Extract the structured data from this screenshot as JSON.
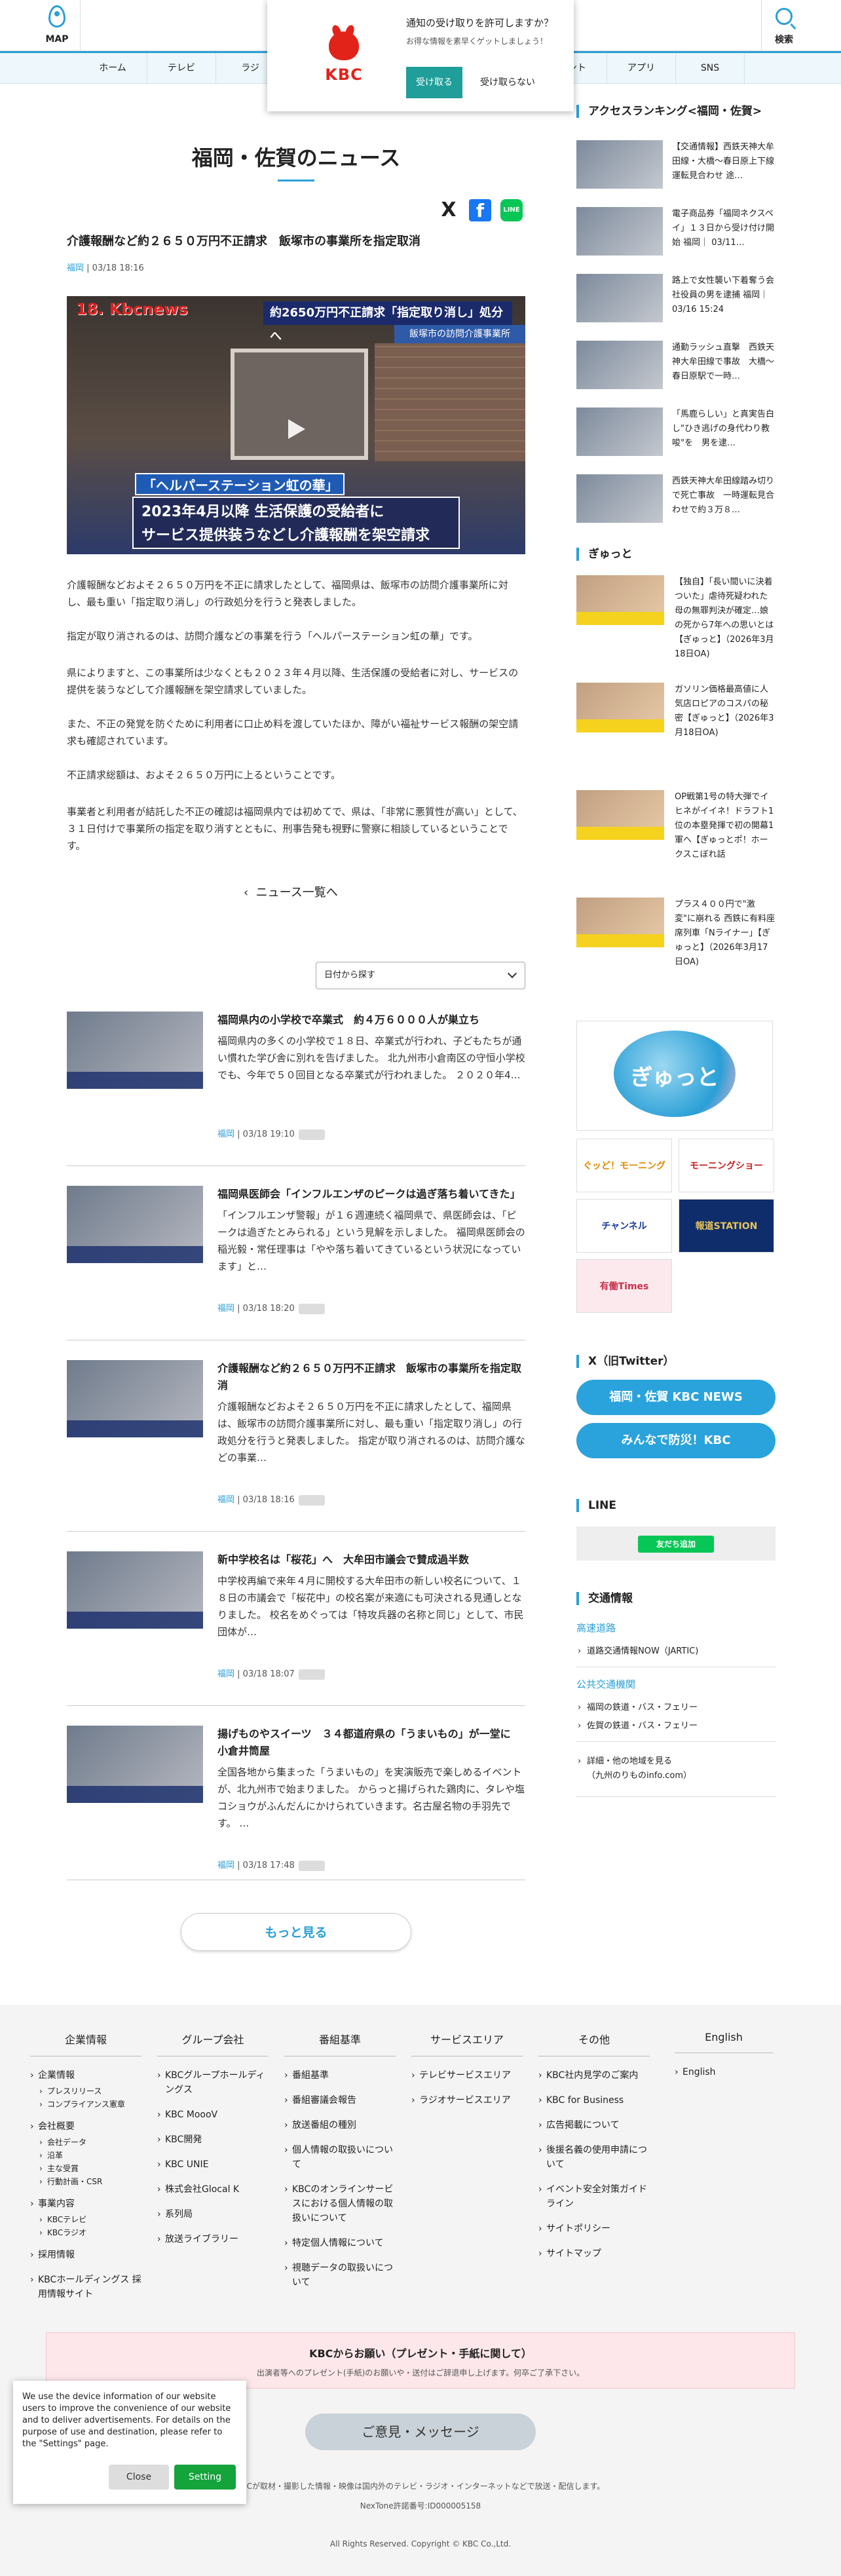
{
  "header": {
    "map_label": "MAP",
    "search_label": "検索",
    "nav_left": [
      "ホーム",
      "テレビ",
      "ラジ"
    ],
    "nav_right": [
      "ベント",
      "アプリ",
      "SNS"
    ]
  },
  "notification": {
    "logo_text": "KBC",
    "title": "通知の受け取りを許可しますか？",
    "subtitle": "お得な情報を素早くゲットしましょう！",
    "accept": "受け取る",
    "decline": "受け取らない"
  },
  "page": {
    "title": "福岡・佐賀のニュース"
  },
  "share": {
    "x": "X",
    "facebook": "f",
    "line": "LINE"
  },
  "article": {
    "title": "介護報酬など約２６５０万円不正請求　飯塚市の事業所を指定取消",
    "category": "福岡",
    "date": "03/18 18:16",
    "video": {
      "channel": "18. Kbcnews",
      "telop1": "約2650万円不正請求「指定取り消し」処分へ",
      "telop2": "飯塚市の訪問介護事業所",
      "caption1": "「ヘルパーステーション虹の華」",
      "caption2_line1": "2023年4月以降 生活保護の受給者に",
      "caption2_line2": "サービス提供装うなどし介護報酬を架空請求"
    },
    "paragraphs": [
      "介護報酬などおよそ２６５０万円を不正に請求したとして、福岡県は、飯塚市の訪問介護事業所に対し、最も重い「指定取り消し」の行政処分を行うと発表しました。",
      "指定が取り消されるのは、訪問介護などの事業を行う「ヘルパーステーション虹の華」です。",
      "県によりますと、この事業所は少なくとも２０２３年４月以降、生活保護の受給者に対し、サービスの提供を装うなどして介護報酬を架空請求していました。",
      "また、不正の発覚を防ぐために利用者に口止め料を渡していたほか、障がい福祉サービス報酬の架空請求も確認されています。",
      "不正請求総額は、およそ２６５０万円に上るということです。",
      "事業者と利用者が結託した不正の確認は福岡県内では初めてで、県は、「非常に悪質性が高い」として、３１日付けで事業所の指定を取り消すとともに、刑事告発も視野に警察に相談しているということです。"
    ],
    "back_link": "ニュース一覧へ"
  },
  "date_select": {
    "label": "日付から探す"
  },
  "news_list": [
    {
      "title": "福岡県内の小学校で卒業式　約４万６０００人が巣立ち",
      "desc": "福岡県内の多くの小学校で１８日、卒業式が行われ、子どもたちが通い慣れた学び舎に別れを告げました。 北九州市小倉南区の守恒小学校でも、今年で５０回目となる卒業式が行われました。 ２０２０年4…",
      "category": "福岡",
      "date": "03/18 19:10"
    },
    {
      "title": "福岡県医師会「インフルエンザのピークは過ぎ落ち着いてきた」",
      "desc": "「インフルエンザ警報」が１６週連続く福岡県で、県医師会は、「ピークは過ぎたとみられる」という見解を示しました。 福岡県医師会の稲光毅・常任理事は「やや落ち着いてきているという状況になっています」と…",
      "category": "福岡",
      "date": "03/18 18:20"
    },
    {
      "title": "介護報酬など約２６５０万円不正請求　飯塚市の事業所を指定取消",
      "desc": "介護報酬などおよそ２６５０万円を不正に請求したとして、福岡県は、飯塚市の訪問介護事業所に対し、最も重い「指定取り消し」の行政処分を行うと発表しました。 指定が取り消されるのは、訪問介護などの事業…",
      "category": "福岡",
      "date": "03/18 18:16"
    },
    {
      "title": "新中学校名は「桜花」へ　大牟田市議会で賛成過半数",
      "desc": "中学校再編で来年４月に開校する大牟田市の新しい校名について、１８日の市議会で「桜花中」の校名案が来適にも可決される見通しとなりました。 校名をめぐっては「特攻兵器の名称と同じ」として、市民団体が…",
      "category": "福岡",
      "date": "03/18 18:07"
    },
    {
      "title": "揚げものやスイーツ　３４都道府県の「うまいもの」が一堂に　小倉井筒屋",
      "desc": "全国各地から集まった「うまいもの」を実演販売で楽しめるイベントが、北九州市で始まりました。 からっと揚げられた鶏肉に、タレや塩コショウがふんだんにかけられていきます。名古屋名物の手羽先です。 …",
      "category": "福岡",
      "date": "03/18 17:48"
    }
  ],
  "more_button": "もっと見る",
  "sidebar": {
    "ranking_heading": "アクセスランキング<福岡・佐賀>",
    "ranking": [
      "【交通情報】西鉄天神大牟田線・大橋～春日原上下線運転見合わせ 途…",
      "電子商品券「福岡ネクスペイ」１３日から受け付け開始 福岡｜ 03/11…",
      "路上で女性襲い下着奪う会社役員の男を逮捕 福岡｜ 03/16 15:24",
      "通勤ラッシュ直撃　西鉄天神大牟田線で事故　大橋～春日原駅で一時…",
      "「馬鹿らしい」と真実告白し\"ひき逃げの身代わり教唆\"を　男を逮…",
      "西鉄天神大牟田線踏み切りで死亡事故　一時運転見合わせで約３万８…"
    ],
    "gyutto_heading": "ぎゅっと",
    "gyutto": [
      "【独自】「長い間いに決着ついた」虐待死疑われた母の無罪判決が確定…娘の死から7年への思いとは【ぎゅっと】（2026年3月18日OA)",
      "ガソリン価格最高値に人気店ロピアのコスパの秘密【ぎゅっと】（2026年3月18日OA)",
      "OP戦第1号の特大弾でイヒネがイイネ！ドラフト1位の本塁発揮で初の開幕1軍へ【ぎゅっとポ！ホークスこぼれ話",
      "プラス４００円で\"激変\"に崩れる 西鉄に有料座席列車「Nライナー」【ぎゅっと】（2026年3月17日OA)"
    ],
    "banner_big": "ぎゅっと",
    "banners": [
      "ぐッど！モーニング",
      "モーニングショー",
      "チャンネル",
      "報道STATION",
      "有働Times"
    ],
    "twitter_heading": "X（旧Twitter）",
    "twitter_buttons": [
      "福岡・佐賀 KBC NEWS",
      "みんなで防災！KBC"
    ],
    "line_heading": "LINE",
    "line_button": "友だち追加",
    "traffic_heading": "交通情報",
    "road_label": "高速道路",
    "road_link": "道路交通情報NOW（JARTIC)",
    "public_label": "公共交通機関",
    "public_links": [
      "福岡の鉄道・バス・フェリー",
      "佐賀の鉄道・バス・フェリー"
    ],
    "detail_link_1": "詳細・他の地域を見る",
    "detail_link_2": "（九州のりものinfo.com）"
  },
  "footer": {
    "cols": [
      {
        "heading": "企業情報",
        "items": [
          {
            "t": "企業情報",
            "sub": [
              "プレスリリース",
              "コンプライアンス憲章"
            ]
          },
          {
            "t": "会社概要",
            "sub": [
              "会社データ",
              "沿革",
              "主な受賞",
              "行動計画・CSR"
            ]
          },
          {
            "t": "事業内容",
            "sub": [
              "KBCテレビ",
              "KBCラジオ"
            ]
          },
          {
            "t": "採用情報",
            "sub": []
          },
          {
            "t": "KBCホールディングス 採用情報サイト",
            "sub": []
          }
        ]
      },
      {
        "heading": "グループ会社",
        "items": [
          {
            "t": "KBCグループホールディングス",
            "sub": []
          },
          {
            "t": "KBC MoooV",
            "sub": []
          },
          {
            "t": "KBC開発",
            "sub": []
          },
          {
            "t": "KBC UNIE",
            "sub": []
          },
          {
            "t": "株式会社Glocal K",
            "sub": []
          },
          {
            "t": "系列局",
            "sub": []
          },
          {
            "t": "放送ライブラリー",
            "sub": []
          }
        ]
      },
      {
        "heading": "番組基準",
        "items": [
          {
            "t": "番組基準",
            "sub": []
          },
          {
            "t": "番組審議会報告",
            "sub": []
          },
          {
            "t": "放送番組の種別",
            "sub": []
          },
          {
            "t": "個人情報の取扱いについて",
            "sub": []
          },
          {
            "t": "KBCのオンラインサービスにおける個人情報の取扱いについて",
            "sub": []
          },
          {
            "t": "特定個人情報について",
            "sub": []
          },
          {
            "t": "視聴データの取扱いについて",
            "sub": []
          }
        ]
      },
      {
        "heading": "サービスエリア",
        "items": [
          {
            "t": "テレビサービスエリア",
            "sub": []
          },
          {
            "t": "ラジオサービスエリア",
            "sub": []
          }
        ]
      },
      {
        "heading": "その他",
        "items": [
          {
            "t": "KBC社内見学のご案内",
            "sub": []
          },
          {
            "t": "KBC for Business",
            "sub": []
          },
          {
            "t": "広告掲載について",
            "sub": []
          },
          {
            "t": "後援名義の使用申請について",
            "sub": []
          },
          {
            "t": "イベント安全対策ガイドライン",
            "sub": []
          },
          {
            "t": "サイトポリシー",
            "sub": []
          },
          {
            "t": "サイトマップ",
            "sub": []
          }
        ]
      },
      {
        "heading": "English",
        "items": [
          {
            "t": "English",
            "sub": []
          }
        ]
      }
    ],
    "present_title": "KBCからお願い（プレゼント・手紙に関して）",
    "present_sub": "出演者等へのプレゼント(手紙)のお願いや・送付はご辞退申し上げます。何卒ご了承下さい。",
    "opinion_button": "ご意見・メッセージ",
    "note1": "KBCが取材・撮影した情報・映像は国内外のテレビ・ラジオ・インターネットなどで放送・配信します。",
    "note2": "NexTone許諾番号:ID000005158",
    "copyright": "All Rights Reserved. Copyright © KBC Co.,Ltd."
  },
  "cookie": {
    "text": "We use the device information of our website users to improve the convenience of our website and to deliver advertisements. For details on the purpose of use and destination, please refer to the \"Settings\" page.",
    "close": "Close",
    "setting": "Setting"
  },
  "colors": {
    "accent": "#2a9fd6",
    "brand_red": "#e2231a",
    "line_green": "#06c755"
  }
}
